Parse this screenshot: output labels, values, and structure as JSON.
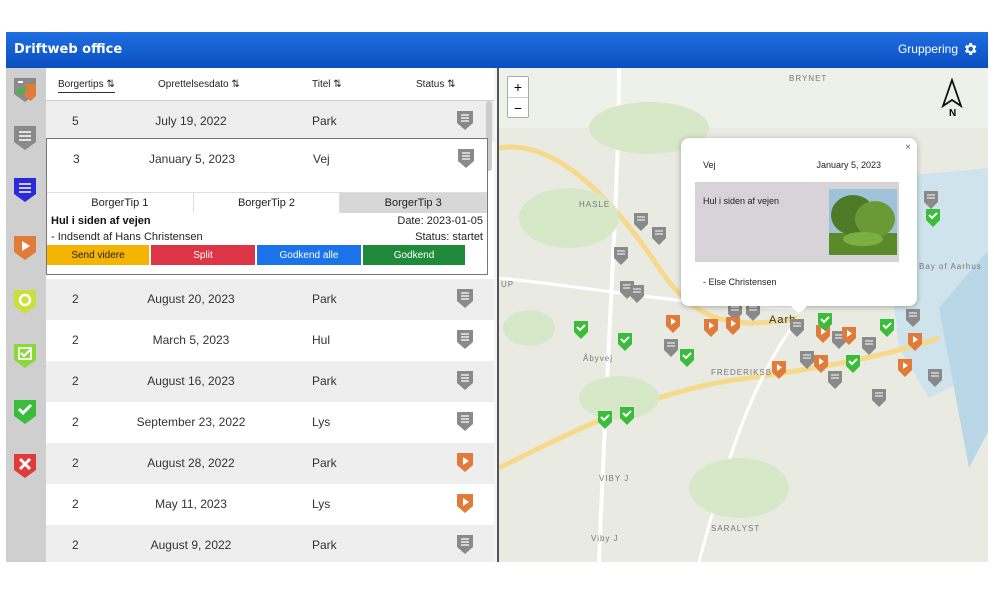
{
  "app": {
    "title": "Driftweb office",
    "grouping_label": "Gruppering"
  },
  "colors": {
    "header": "#0a4fc2",
    "gray_marker": "#8a8a8a",
    "orange": "#e07b3a",
    "green": "#3bbd3b",
    "red": "#e03a3a",
    "yellow_btn": "#f5b400",
    "red_btn": "#dc3545",
    "blue_btn": "#1a73e8",
    "green_btn": "#1f8a3a"
  },
  "sidebar": {
    "items": [
      {
        "name": "filter-combined-icon"
      },
      {
        "name": "filter-list-gray-icon"
      },
      {
        "name": "filter-list-blue-icon"
      },
      {
        "name": "filter-play-orange-icon"
      },
      {
        "name": "filter-circle-yellow-icon"
      },
      {
        "name": "filter-check-box-green-icon"
      },
      {
        "name": "filter-check-green-icon"
      },
      {
        "name": "filter-x-red-icon"
      }
    ]
  },
  "table": {
    "columns": [
      "Borgertips ⇅",
      "Oprettelsesdato ⇅",
      "Titel ⇅",
      "Status ⇅"
    ],
    "rows": [
      {
        "count": "5",
        "date": "July 19, 2022",
        "title": "Park",
        "status": "gray"
      },
      {
        "count": "3",
        "date": "January 5, 2023",
        "title": "Vej",
        "status": "gray"
      },
      {
        "count": "2",
        "date": "August 20, 2023",
        "title": "Park",
        "status": "gray"
      },
      {
        "count": "2",
        "date": "March 5, 2023",
        "title": "Hul",
        "status": "gray"
      },
      {
        "count": "2",
        "date": "August 16, 2023",
        "title": "Park",
        "status": "gray"
      },
      {
        "count": "2",
        "date": "September 23, 2022",
        "title": "Lys",
        "status": "gray"
      },
      {
        "count": "2",
        "date": "August 28, 2022",
        "title": "Park",
        "status": "orange"
      },
      {
        "count": "2",
        "date": "May 11, 2023",
        "title": "Lys",
        "status": "orange"
      },
      {
        "count": "2",
        "date": "August 9, 2022",
        "title": "Park",
        "status": "gray"
      }
    ]
  },
  "detail": {
    "tabs": [
      "BorgerTip 1",
      "BorgerTip 2",
      "BorgerTip 3"
    ],
    "selected_tab": "BorgerTip 3",
    "title": "Hul i siden af vejen",
    "date": "Date: 2023-01-05",
    "submitted_by": "- Indsendt af Hans Christensen",
    "status": "Status: startet",
    "buttons": [
      "Send videre",
      "Split",
      "Godkend alle",
      "Godkend"
    ]
  },
  "map": {
    "labels": [
      "BRYNET",
      "HASLE",
      "Åbyvej",
      "FREDERIKSB",
      "VIBY J",
      "SARALYST",
      "Viby J",
      "Bay of Aarhus",
      "Aarh",
      "UP"
    ],
    "popup": {
      "type": "Vej",
      "date": "January 5, 2023",
      "description": "Hul i siden af vejen",
      "author": "- Else Christensen",
      "close": "×"
    }
  }
}
